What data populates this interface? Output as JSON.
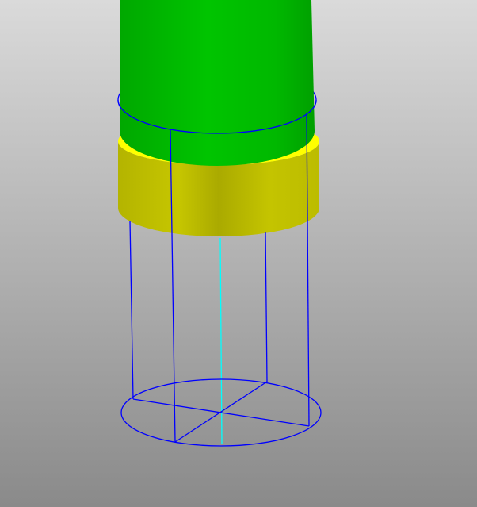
{
  "viewport": {
    "background_top": "#dadada",
    "background_bottom": "#8a8a8a"
  },
  "colors": {
    "green_body": "#00b400",
    "green_highlight": "#00c800",
    "yellow_band": "#c8c800",
    "yellow_rim": "#ffff00",
    "wireframe": "#0000ff",
    "axis": "#00ffff"
  }
}
